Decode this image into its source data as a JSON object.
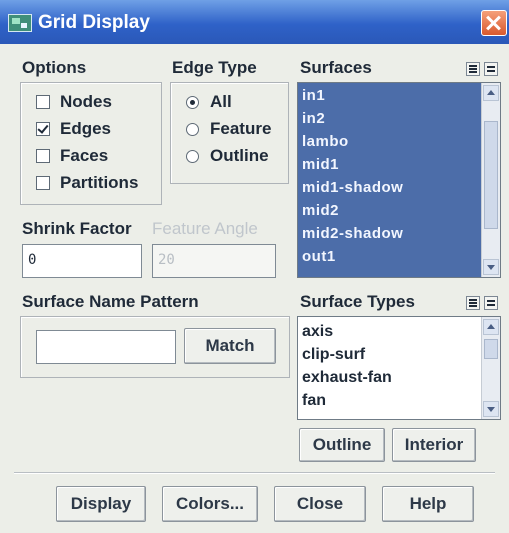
{
  "window": {
    "title": "Grid Display"
  },
  "options": {
    "label": "Options",
    "items": [
      {
        "label": "Nodes",
        "checked": false
      },
      {
        "label": "Edges",
        "checked": true
      },
      {
        "label": "Faces",
        "checked": false
      },
      {
        "label": "Partitions",
        "checked": false
      }
    ]
  },
  "edge_type": {
    "label": "Edge Type",
    "items": [
      {
        "label": "All",
        "selected": true
      },
      {
        "label": "Feature",
        "selected": false
      },
      {
        "label": "Outline",
        "selected": false
      }
    ]
  },
  "surfaces": {
    "label": "Surfaces",
    "items": [
      "in1",
      "in2",
      "lambo",
      "mid1",
      "mid1-shadow",
      "mid2",
      "mid2-shadow",
      "out1"
    ],
    "all_selected": true
  },
  "shrink_factor": {
    "label": "Shrink Factor",
    "value": "0"
  },
  "feature_angle": {
    "label": "Feature Angle",
    "value": "20",
    "enabled": false
  },
  "surface_name_pattern": {
    "label": "Surface Name Pattern",
    "value": "",
    "match_label": "Match"
  },
  "surface_types": {
    "label": "Surface Types",
    "items": [
      "axis",
      "clip-surf",
      "exhaust-fan",
      "fan"
    ]
  },
  "type_buttons": {
    "outline": "Outline",
    "interior": "Interior"
  },
  "footer": {
    "display": "Display",
    "colors": "Colors...",
    "close": "Close",
    "help": "Help"
  },
  "colors": {
    "title_bar": "#2f62c8",
    "selection": "#4c6da9",
    "close_button": "#d9592e"
  }
}
